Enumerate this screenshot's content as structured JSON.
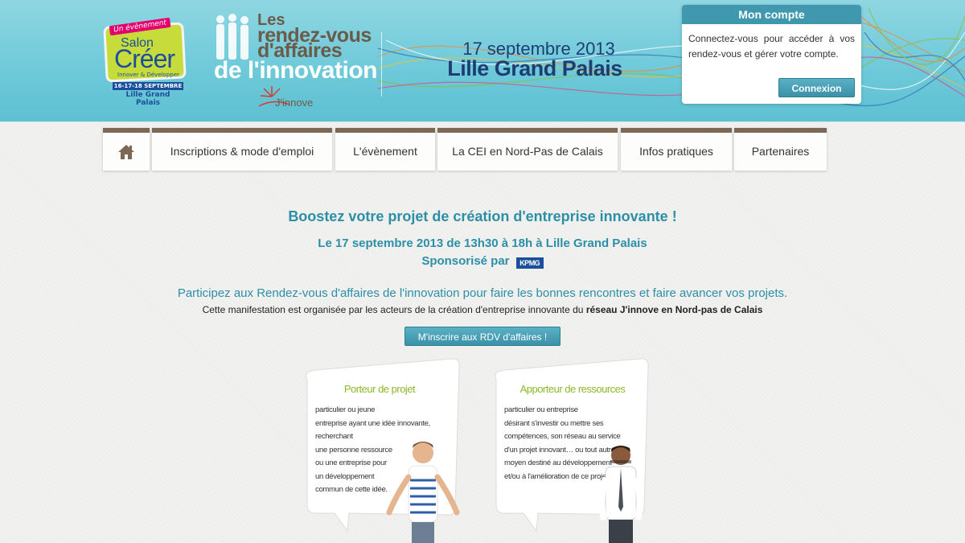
{
  "banner": {
    "salon": {
      "tag": "Un évènement",
      "line1": "Salon",
      "line2": "Créer",
      "line3": "Innover & Développer",
      "dates": "16-17-18 SEPTEMBRE",
      "city": "Lille Grand Palais"
    },
    "rdv": {
      "line1": "Les",
      "line2": "rendez-vous",
      "line3": "d'affaires",
      "line4": "de l'innovation",
      "jinnove": "J'innove"
    },
    "event_date": "17 septembre 2013",
    "event_place": "Lille Grand Palais"
  },
  "account": {
    "title": "Mon compte",
    "text": "Connectez-vous pour accéder à vos rendez-vous et gérer votre compte.",
    "button": "Connexion"
  },
  "nav": {
    "items": [
      {
        "label": "Inscriptions & mode d'emploi"
      },
      {
        "label": "L'évènement"
      },
      {
        "label": "La CEI en Nord-Pas de Calais"
      },
      {
        "label": "Infos pratiques"
      },
      {
        "label": "Partenaires"
      }
    ]
  },
  "main": {
    "headline": "Boostez votre projet de création d'entreprise innovante !",
    "subline": "Le 17 septembre 2013 de 13h30 à 18h à Lille Grand Palais",
    "sponsor_label": "Sponsorisé par",
    "sponsor_logo": "KPMG",
    "intro": "Participez aux Rendez-vous d'affaires de l'innovation pour faire les bonnes rencontres et faire avancer vos projets.",
    "orga_prefix": "Cette manifestation est organisée par les acteurs de la création d'entreprise innovante du ",
    "orga_bold": "réseau J'innove en Nord-pas de Calais",
    "cta": "M'inscrire aux RDV d'affaires !"
  },
  "cards": [
    {
      "title": "Porteur de projet",
      "lines": [
        "particulier ou jeune",
        "entreprise ayant une idée innovante,",
        "recherchant",
        "une personne ressource",
        "ou une entreprise pour",
        "un développement",
        "commun de cette idée."
      ]
    },
    {
      "title": "Apporteur de ressources",
      "lines": [
        "particulier ou entreprise",
        "désirant s'investir ou mettre ses",
        "compétences, son réseau au service",
        "d'un projet innovant… ou tout autre",
        "moyen destiné au développement",
        "et/ou à l'amélioration de ce projet."
      ]
    }
  ],
  "colors": {
    "banner": "#6fcad9",
    "accent": "#2c8fa7",
    "nav_top": "#7d6855",
    "card_title": "#8db827"
  },
  "icons": {
    "home": "home-icon"
  }
}
